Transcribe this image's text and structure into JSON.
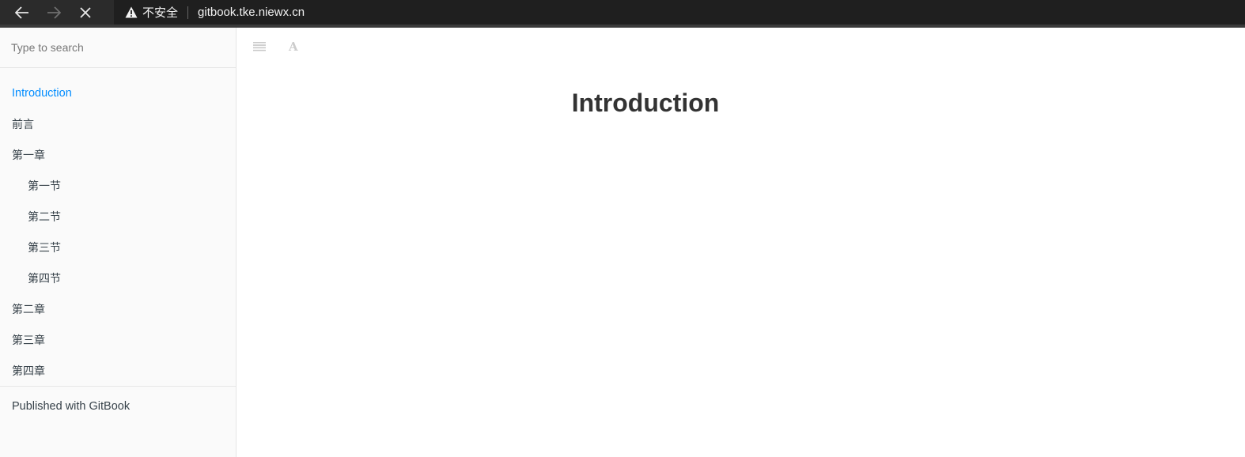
{
  "browser": {
    "back_icon": "arrow-left-icon",
    "forward_icon": "arrow-right-icon",
    "stop_icon": "close-icon",
    "security_icon": "warning-triangle-icon",
    "security_label": "不安全",
    "url": "gitbook.tke.niewx.cn"
  },
  "sidebar": {
    "search_placeholder": "Type to search",
    "items": [
      {
        "label": "Introduction",
        "active": true,
        "level": 1
      },
      {
        "label": "前言",
        "active": false,
        "level": 1
      },
      {
        "label": "第一章",
        "active": false,
        "level": 1
      },
      {
        "label": "第一节",
        "active": false,
        "level": 2
      },
      {
        "label": "第二节",
        "active": false,
        "level": 2
      },
      {
        "label": "第三节",
        "active": false,
        "level": 2
      },
      {
        "label": "第四节",
        "active": false,
        "level": 2
      },
      {
        "label": "第二章",
        "active": false,
        "level": 1
      },
      {
        "label": "第三章",
        "active": false,
        "level": 1
      },
      {
        "label": "第四章",
        "active": false,
        "level": 1
      }
    ],
    "footer": "Published with GitBook"
  },
  "toolbar": {
    "toggle_icon": "list-menu-icon",
    "font_icon": "font-settings-icon",
    "font_glyph": "A"
  },
  "page": {
    "title": "Introduction"
  },
  "colors": {
    "accent": "#008cff",
    "chrome": "#2b2b2b",
    "sidebar_bg": "#fafafa"
  }
}
